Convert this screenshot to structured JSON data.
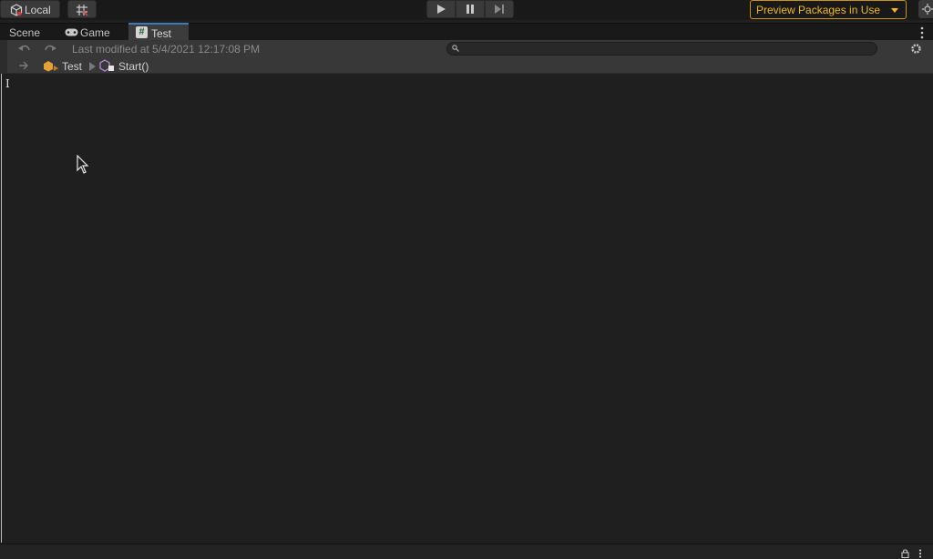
{
  "toolbar": {
    "local_label": "Local",
    "preview_packages_label": "Preview Packages in Use",
    "icons": [
      "cube-icon",
      "grid-icon",
      "play-icon",
      "pause-icon",
      "step-icon",
      "layers-icon"
    ]
  },
  "tabs": [
    {
      "label": "Scene",
      "active": false
    },
    {
      "label": "Game",
      "active": false
    },
    {
      "label": "Test",
      "active": true
    }
  ],
  "editor": {
    "last_modified": "Last modified at 5/4/2021 12:17:08 PM",
    "search_placeholder": "",
    "breadcrumb": [
      "Test",
      "Start()"
    ]
  },
  "colors": {
    "accent_tab": "#3a79bb",
    "preview_warning": "#f0b829",
    "background": "#1f1f1f"
  }
}
